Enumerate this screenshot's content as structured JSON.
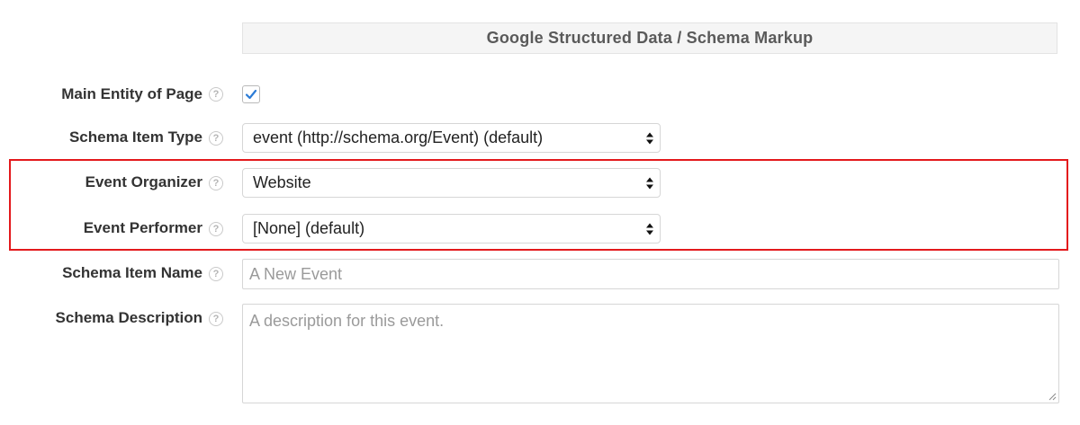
{
  "section": {
    "title": "Google Structured Data / Schema Markup"
  },
  "fields": {
    "main_entity": {
      "label": "Main Entity of Page",
      "checked": true
    },
    "schema_item_type": {
      "label": "Schema Item Type",
      "value": "event (http://schema.org/Event) (default)"
    },
    "event_organizer": {
      "label": "Event Organizer",
      "value": "Website"
    },
    "event_performer": {
      "label": "Event Performer",
      "value": "[None] (default)"
    },
    "schema_item_name": {
      "label": "Schema Item Name",
      "value": "",
      "placeholder": "A New Event"
    },
    "schema_description": {
      "label": "Schema Description",
      "value": "",
      "placeholder": "A description for this event."
    }
  },
  "help_icon_glyph": "?",
  "icons": {
    "help": "question-circle-icon",
    "checkmark": "checkmark-icon",
    "select_arrows": "up-down-arrows-icon",
    "resize": "resize-grip-icon"
  },
  "colors": {
    "highlight_border": "#e3191c",
    "checkmark": "#2b7bd6",
    "header_bg": "#f5f5f5"
  }
}
